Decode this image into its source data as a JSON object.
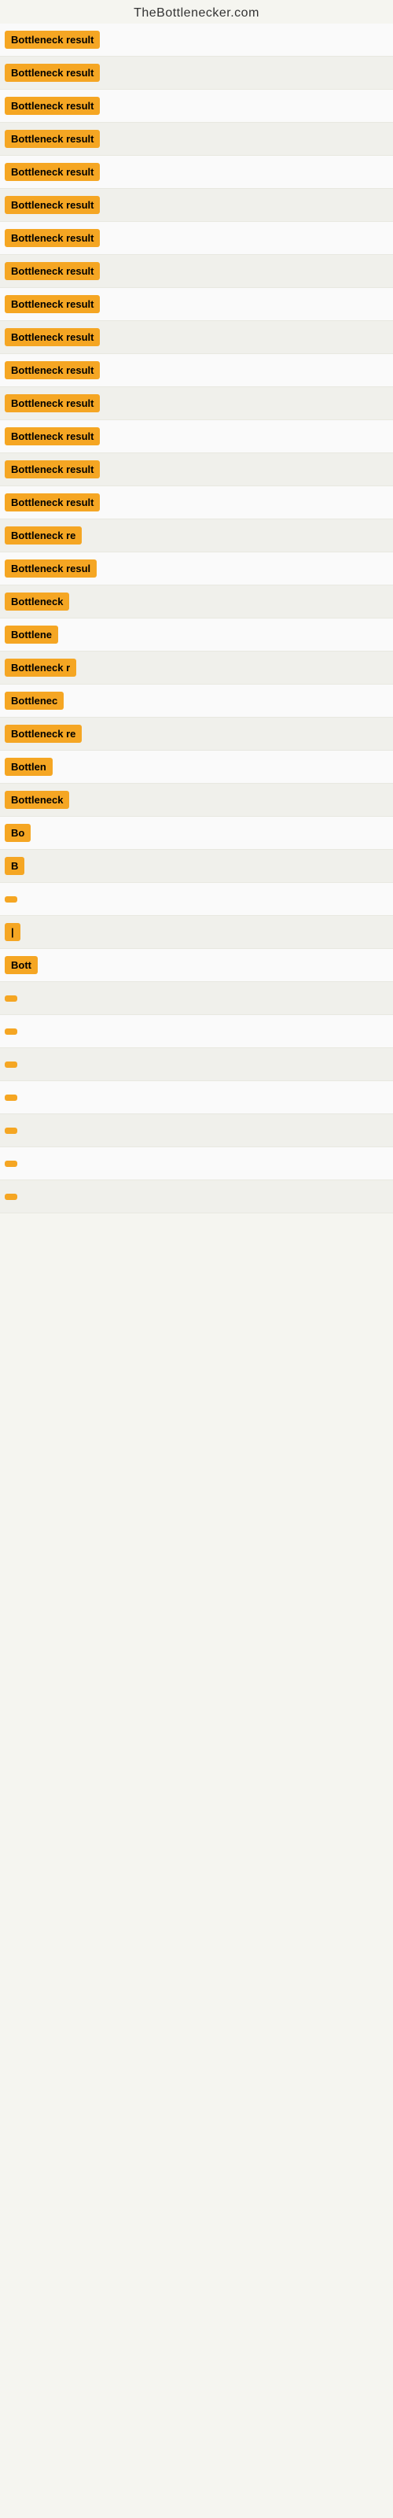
{
  "header": {
    "title": "TheBottlenecker.com"
  },
  "labels": {
    "bottleneck_result": "Bottleneck result"
  },
  "rows": [
    {
      "id": 1,
      "labelClass": "label-full",
      "text": "Bottleneck result"
    },
    {
      "id": 2,
      "labelClass": "label-full",
      "text": "Bottleneck result"
    },
    {
      "id": 3,
      "labelClass": "label-full",
      "text": "Bottleneck result"
    },
    {
      "id": 4,
      "labelClass": "label-full",
      "text": "Bottleneck result"
    },
    {
      "id": 5,
      "labelClass": "label-full",
      "text": "Bottleneck result"
    },
    {
      "id": 6,
      "labelClass": "label-full",
      "text": "Bottleneck result"
    },
    {
      "id": 7,
      "labelClass": "label-full",
      "text": "Bottleneck result"
    },
    {
      "id": 8,
      "labelClass": "label-full",
      "text": "Bottleneck result"
    },
    {
      "id": 9,
      "labelClass": "label-full",
      "text": "Bottleneck result"
    },
    {
      "id": 10,
      "labelClass": "label-full",
      "text": "Bottleneck result"
    },
    {
      "id": 11,
      "labelClass": "label-full",
      "text": "Bottleneck result"
    },
    {
      "id": 12,
      "labelClass": "label-full",
      "text": "Bottleneck result"
    },
    {
      "id": 13,
      "labelClass": "label-full",
      "text": "Bottleneck result"
    },
    {
      "id": 14,
      "labelClass": "label-full",
      "text": "Bottleneck result"
    },
    {
      "id": 15,
      "labelClass": "label-full",
      "text": "Bottleneck result"
    },
    {
      "id": 16,
      "labelClass": "label-large",
      "text": "Bottleneck re"
    },
    {
      "id": 17,
      "labelClass": "label-large",
      "text": "Bottleneck resul"
    },
    {
      "id": 18,
      "labelClass": "label-medium",
      "text": "Bottleneck"
    },
    {
      "id": 19,
      "labelClass": "label-small",
      "text": "Bottlene"
    },
    {
      "id": 20,
      "labelClass": "label-medium",
      "text": "Bottleneck r"
    },
    {
      "id": 21,
      "labelClass": "label-small",
      "text": "Bottlenec"
    },
    {
      "id": 22,
      "labelClass": "label-large",
      "text": "Bottleneck re"
    },
    {
      "id": 23,
      "labelClass": "label-small",
      "text": "Bottlen"
    },
    {
      "id": 24,
      "labelClass": "label-small",
      "text": "Bottleneck"
    },
    {
      "id": 25,
      "labelClass": "label-smaller",
      "text": "Bo"
    },
    {
      "id": 26,
      "labelClass": "label-tiny",
      "text": "B"
    },
    {
      "id": 27,
      "labelClass": "label-mini",
      "text": ""
    },
    {
      "id": 28,
      "labelClass": "label-smaller",
      "text": "|"
    },
    {
      "id": 29,
      "labelClass": "label-small",
      "text": "Bott"
    },
    {
      "id": 30,
      "labelClass": "label-micro",
      "text": ""
    },
    {
      "id": 31,
      "labelClass": "label-micro",
      "text": ""
    },
    {
      "id": 32,
      "labelClass": "label-micro",
      "text": ""
    },
    {
      "id": 33,
      "labelClass": "label-micro",
      "text": ""
    },
    {
      "id": 34,
      "labelClass": "label-micro",
      "text": ""
    },
    {
      "id": 35,
      "labelClass": "label-micro",
      "text": ""
    },
    {
      "id": 36,
      "labelClass": "label-micro",
      "text": ""
    }
  ]
}
